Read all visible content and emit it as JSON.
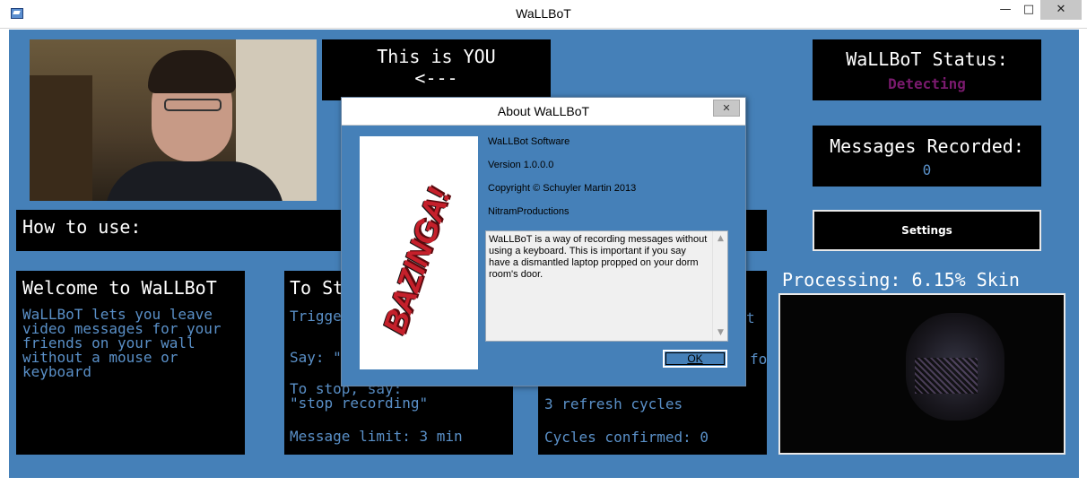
{
  "window": {
    "title": "WaLLBoT",
    "minimize": "—",
    "maximize": "□",
    "close": "✕"
  },
  "panels": {
    "you": {
      "line1": "This is YOU",
      "line2": "<---"
    },
    "status": {
      "title": "WaLLBoT Status:",
      "value": "Detecting",
      "value_color": "#7a1a6e"
    },
    "messages": {
      "title": "Messages Recorded:",
      "value": "0"
    },
    "settings": {
      "label": "Settings"
    },
    "howto": {
      "title": "How to use:"
    },
    "welcome": {
      "title": "Welcome to WaLLBoT",
      "body": "WaLLBoT lets you leave video messages for your friends on your wall without a mouse or keyboard"
    },
    "tostart": {
      "title": "To St",
      "trigger": "Trigge",
      "say": "Say: \"",
      "stop_label": "To stop, say:",
      "stop_phrase": "\"stop recording\"",
      "limit": "Message limit: 3 min"
    },
    "middle": {
      "edge_t": "t",
      "edge_fo": "fo",
      "refresh": "3 refresh cycles",
      "confirmed": "Cycles confirmed: 0"
    },
    "processing": {
      "label": "Processing: 6.15% Skin"
    }
  },
  "dialog": {
    "title": "About WaLLBoT",
    "close": "✕",
    "logo_text": "BAZINGA!",
    "product": "WaLLBot Software",
    "version": "Version 1.0.0.0",
    "copyright": "Copyright © Schuyler Martin 2013",
    "company": "NitramProductions",
    "description": "WaLLBoT is a way of recording messages without using a keyboard. This is important if you say have a dismantled laptop propped on your dorm room's door.",
    "ok": "OK"
  },
  "colors": {
    "background": "#4580b8",
    "panel": "#000000",
    "text_blue": "#5a90c8",
    "status_purple": "#7a1a6e"
  }
}
